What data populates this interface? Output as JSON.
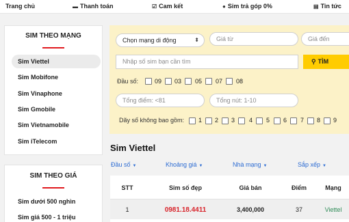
{
  "topnav": [
    {
      "label": "Trang chủ",
      "icon": "none"
    },
    {
      "label": "Thanh toán",
      "icon": "card-icon"
    },
    {
      "label": "Cam kết",
      "icon": "checklist-icon"
    },
    {
      "label": "Sim trả góp 0%",
      "icon": "piggy-bank-icon"
    },
    {
      "label": "Tin tức",
      "icon": "news-icon"
    }
  ],
  "sidebar_network": {
    "title": "SIM THEO MẠNG",
    "items": [
      "Sim Viettel",
      "Sim Mobifone",
      "Sim Vinaphone",
      "Sim Gmobile",
      "Sim Vietnamobile",
      "Sim iTelecom"
    ],
    "active_index": 0
  },
  "sidebar_price": {
    "title": "SIM THEO GIÁ",
    "items": [
      "Sim dưới 500 nghìn",
      "Sim giá 500 - 1 triệu"
    ]
  },
  "filter": {
    "network_select": "Chọn mạng di động",
    "price_from_placeholder": "Giá từ",
    "price_to_placeholder": "Giá đến",
    "search_placeholder": "Nhập số sim bạn cần tìm",
    "search_button": "TÌM",
    "prefix_label": "Đầu số:",
    "prefixes": [
      "09",
      "03",
      "05",
      "07",
      "08"
    ],
    "total_placeholder": "Tổng điểm: <81",
    "nut_placeholder": "Tổng nút: 1-10",
    "exclude_label": "Dãy số không bao gồm:",
    "exclude_digits": [
      "1",
      "2",
      "3",
      "4",
      "5",
      "6",
      "7",
      "8",
      "9"
    ]
  },
  "section_title": "Sim Viettel",
  "sorts": [
    "Đầu số",
    "Khoảng giá",
    "Nhà mạng",
    "Sắp xếp"
  ],
  "table": {
    "headers": [
      "STT",
      "Sim số đẹp",
      "Giá bán",
      "Điểm",
      "Mạng"
    ],
    "rows": [
      {
        "stt": "1",
        "sim": "0981.18.4411",
        "price": "3,400,000",
        "points": "37",
        "network": "Viettel"
      }
    ]
  },
  "colors": {
    "accent_red": "#e0191e",
    "filter_bg": "#fcf2c8",
    "search_yellow": "#ffcc00",
    "sim_red": "#d8232a",
    "network_green": "#2e8b57",
    "link_blue": "#2a6ad2"
  }
}
